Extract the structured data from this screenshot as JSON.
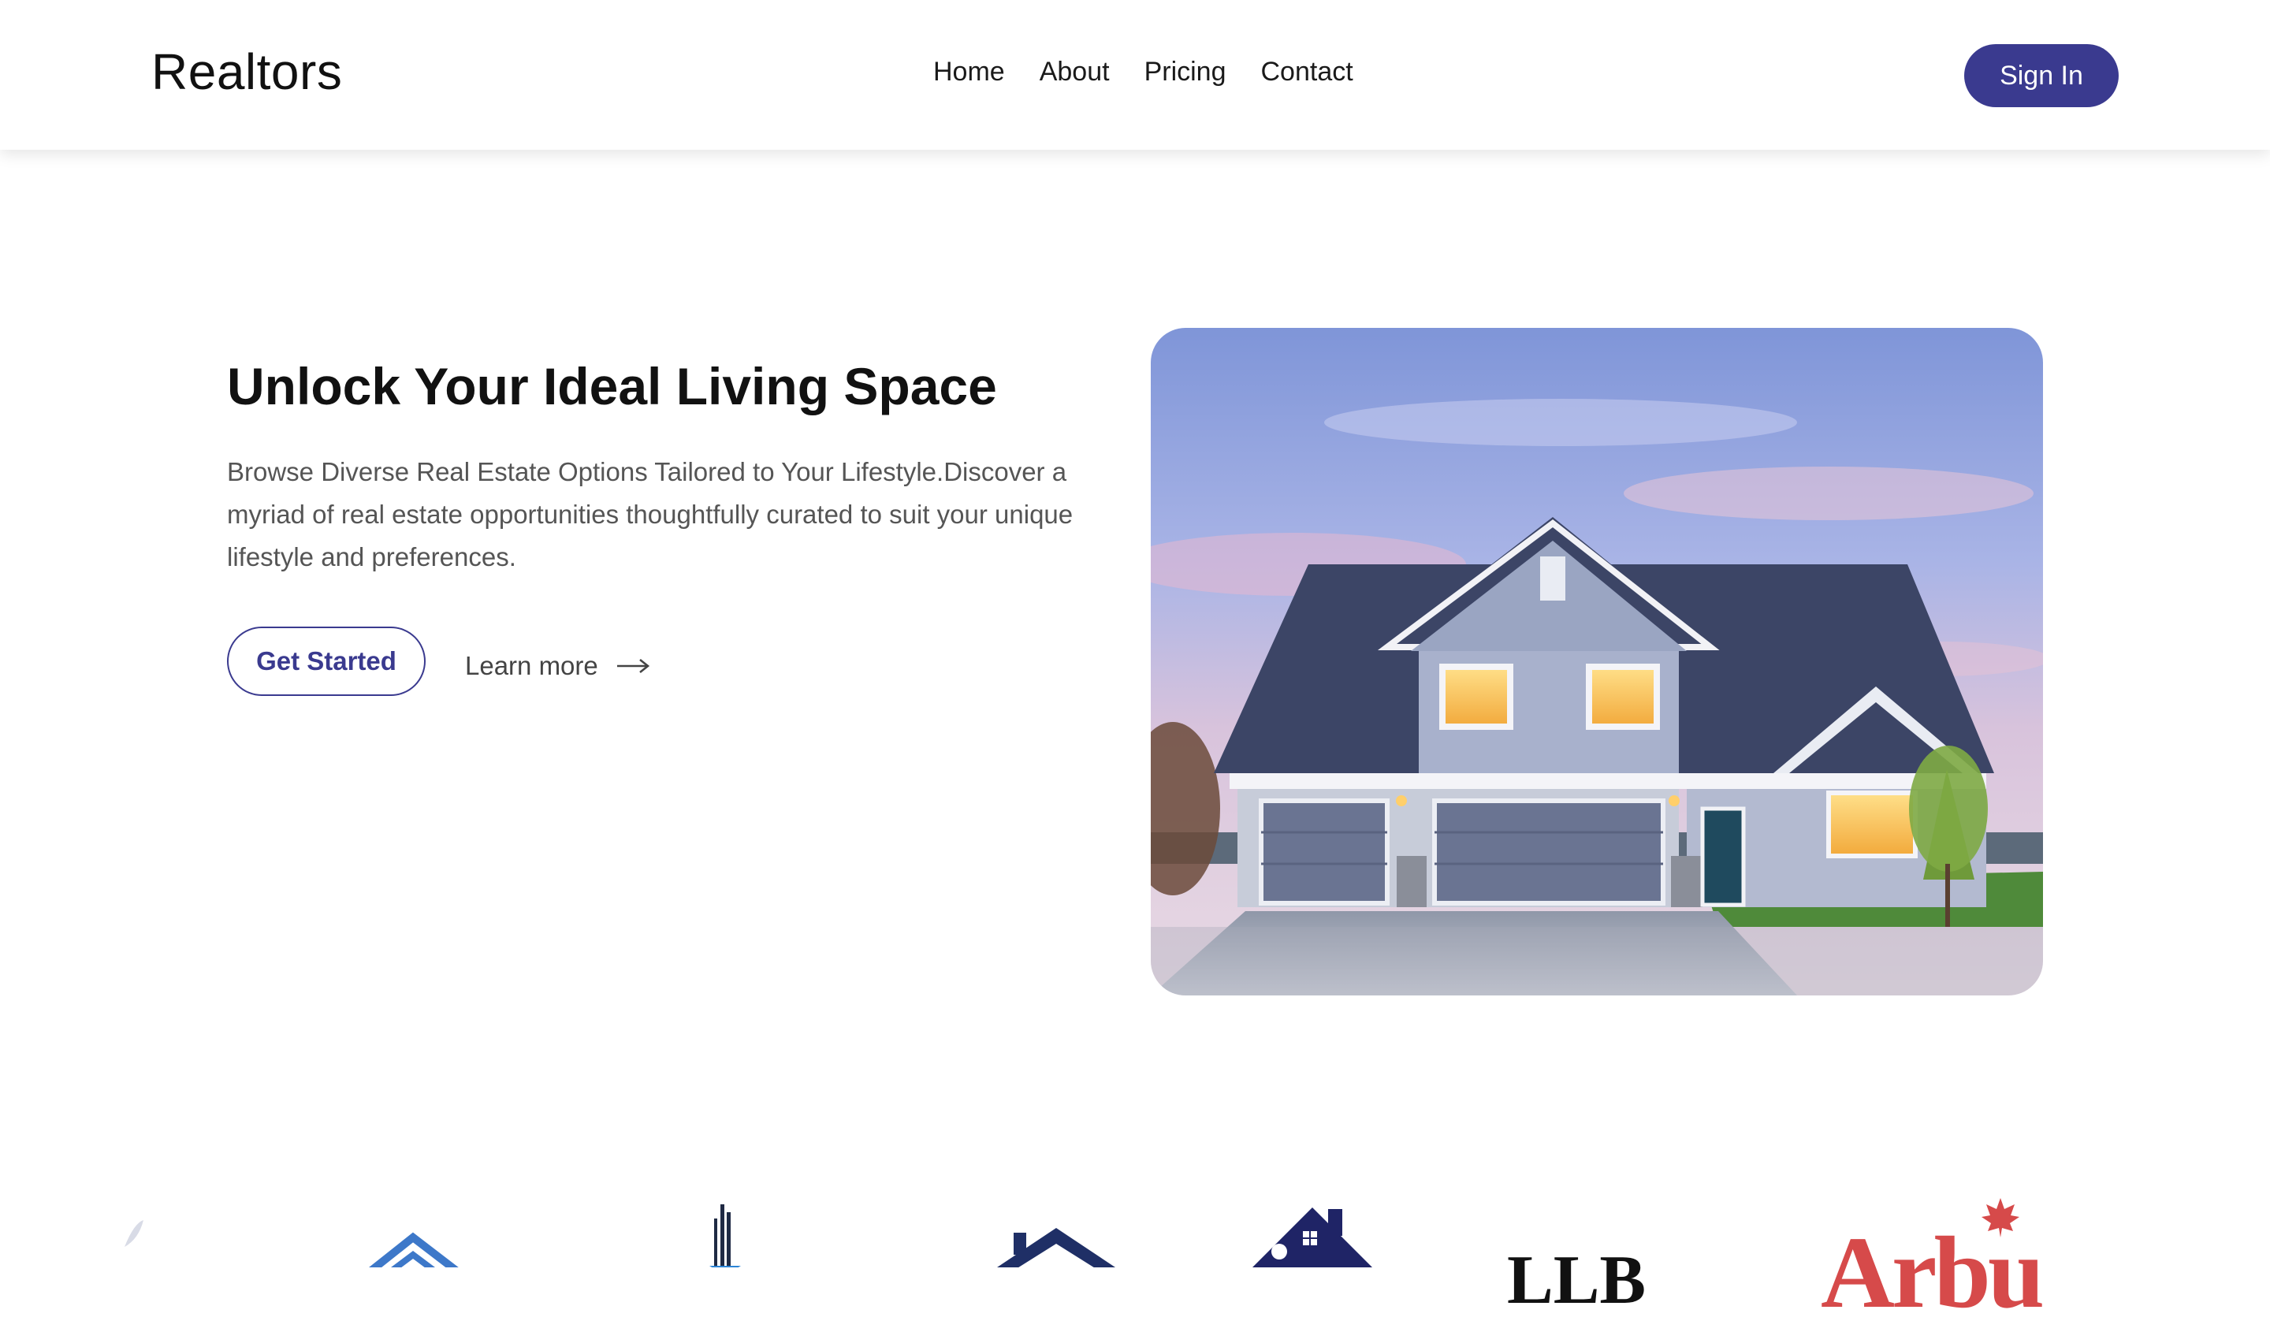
{
  "header": {
    "brand": "Realtors",
    "nav": [
      "Home",
      "About",
      "Pricing",
      "Contact"
    ],
    "sign_in": "Sign In"
  },
  "hero": {
    "title": "Unlock Your Ideal Living Space",
    "description": "Browse Diverse Real Estate Options Tailored to Your Lifestyle.Discover a myriad of real estate opportunities thoughtfully curated to suit your unique lifestyle and preferences.",
    "primary_button": "Get Started",
    "secondary_link": "Learn more",
    "secondary_icon": "arrow-right-icon",
    "image_subject": "suburban-house"
  },
  "partner_logos": {
    "lb_text": "LLB",
    "arbu_text": "Arbu"
  },
  "colors": {
    "accent": "#3a3a8f",
    "text_dark": "#111111",
    "text_muted": "#555555"
  }
}
